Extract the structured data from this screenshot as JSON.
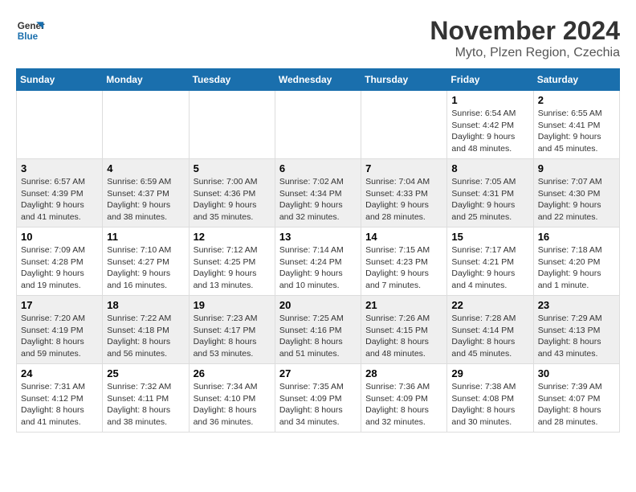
{
  "header": {
    "logo_line1": "General",
    "logo_line2": "Blue",
    "title": "November 2024",
    "subtitle": "Myto, Plzen Region, Czechia"
  },
  "calendar": {
    "weekdays": [
      "Sunday",
      "Monday",
      "Tuesday",
      "Wednesday",
      "Thursday",
      "Friday",
      "Saturday"
    ],
    "rows": [
      [
        {
          "day": "",
          "info": ""
        },
        {
          "day": "",
          "info": ""
        },
        {
          "day": "",
          "info": ""
        },
        {
          "day": "",
          "info": ""
        },
        {
          "day": "",
          "info": ""
        },
        {
          "day": "1",
          "info": "Sunrise: 6:54 AM\nSunset: 4:42 PM\nDaylight: 9 hours\nand 48 minutes."
        },
        {
          "day": "2",
          "info": "Sunrise: 6:55 AM\nSunset: 4:41 PM\nDaylight: 9 hours\nand 45 minutes."
        }
      ],
      [
        {
          "day": "3",
          "info": "Sunrise: 6:57 AM\nSunset: 4:39 PM\nDaylight: 9 hours\nand 41 minutes."
        },
        {
          "day": "4",
          "info": "Sunrise: 6:59 AM\nSunset: 4:37 PM\nDaylight: 9 hours\nand 38 minutes."
        },
        {
          "day": "5",
          "info": "Sunrise: 7:00 AM\nSunset: 4:36 PM\nDaylight: 9 hours\nand 35 minutes."
        },
        {
          "day": "6",
          "info": "Sunrise: 7:02 AM\nSunset: 4:34 PM\nDaylight: 9 hours\nand 32 minutes."
        },
        {
          "day": "7",
          "info": "Sunrise: 7:04 AM\nSunset: 4:33 PM\nDaylight: 9 hours\nand 28 minutes."
        },
        {
          "day": "8",
          "info": "Sunrise: 7:05 AM\nSunset: 4:31 PM\nDaylight: 9 hours\nand 25 minutes."
        },
        {
          "day": "9",
          "info": "Sunrise: 7:07 AM\nSunset: 4:30 PM\nDaylight: 9 hours\nand 22 minutes."
        }
      ],
      [
        {
          "day": "10",
          "info": "Sunrise: 7:09 AM\nSunset: 4:28 PM\nDaylight: 9 hours\nand 19 minutes."
        },
        {
          "day": "11",
          "info": "Sunrise: 7:10 AM\nSunset: 4:27 PM\nDaylight: 9 hours\nand 16 minutes."
        },
        {
          "day": "12",
          "info": "Sunrise: 7:12 AM\nSunset: 4:25 PM\nDaylight: 9 hours\nand 13 minutes."
        },
        {
          "day": "13",
          "info": "Sunrise: 7:14 AM\nSunset: 4:24 PM\nDaylight: 9 hours\nand 10 minutes."
        },
        {
          "day": "14",
          "info": "Sunrise: 7:15 AM\nSunset: 4:23 PM\nDaylight: 9 hours\nand 7 minutes."
        },
        {
          "day": "15",
          "info": "Sunrise: 7:17 AM\nSunset: 4:21 PM\nDaylight: 9 hours\nand 4 minutes."
        },
        {
          "day": "16",
          "info": "Sunrise: 7:18 AM\nSunset: 4:20 PM\nDaylight: 9 hours\nand 1 minute."
        }
      ],
      [
        {
          "day": "17",
          "info": "Sunrise: 7:20 AM\nSunset: 4:19 PM\nDaylight: 8 hours\nand 59 minutes."
        },
        {
          "day": "18",
          "info": "Sunrise: 7:22 AM\nSunset: 4:18 PM\nDaylight: 8 hours\nand 56 minutes."
        },
        {
          "day": "19",
          "info": "Sunrise: 7:23 AM\nSunset: 4:17 PM\nDaylight: 8 hours\nand 53 minutes."
        },
        {
          "day": "20",
          "info": "Sunrise: 7:25 AM\nSunset: 4:16 PM\nDaylight: 8 hours\nand 51 minutes."
        },
        {
          "day": "21",
          "info": "Sunrise: 7:26 AM\nSunset: 4:15 PM\nDaylight: 8 hours\nand 48 minutes."
        },
        {
          "day": "22",
          "info": "Sunrise: 7:28 AM\nSunset: 4:14 PM\nDaylight: 8 hours\nand 45 minutes."
        },
        {
          "day": "23",
          "info": "Sunrise: 7:29 AM\nSunset: 4:13 PM\nDaylight: 8 hours\nand 43 minutes."
        }
      ],
      [
        {
          "day": "24",
          "info": "Sunrise: 7:31 AM\nSunset: 4:12 PM\nDaylight: 8 hours\nand 41 minutes."
        },
        {
          "day": "25",
          "info": "Sunrise: 7:32 AM\nSunset: 4:11 PM\nDaylight: 8 hours\nand 38 minutes."
        },
        {
          "day": "26",
          "info": "Sunrise: 7:34 AM\nSunset: 4:10 PM\nDaylight: 8 hours\nand 36 minutes."
        },
        {
          "day": "27",
          "info": "Sunrise: 7:35 AM\nSunset: 4:09 PM\nDaylight: 8 hours\nand 34 minutes."
        },
        {
          "day": "28",
          "info": "Sunrise: 7:36 AM\nSunset: 4:09 PM\nDaylight: 8 hours\nand 32 minutes."
        },
        {
          "day": "29",
          "info": "Sunrise: 7:38 AM\nSunset: 4:08 PM\nDaylight: 8 hours\nand 30 minutes."
        },
        {
          "day": "30",
          "info": "Sunrise: 7:39 AM\nSunset: 4:07 PM\nDaylight: 8 hours\nand 28 minutes."
        }
      ]
    ]
  }
}
